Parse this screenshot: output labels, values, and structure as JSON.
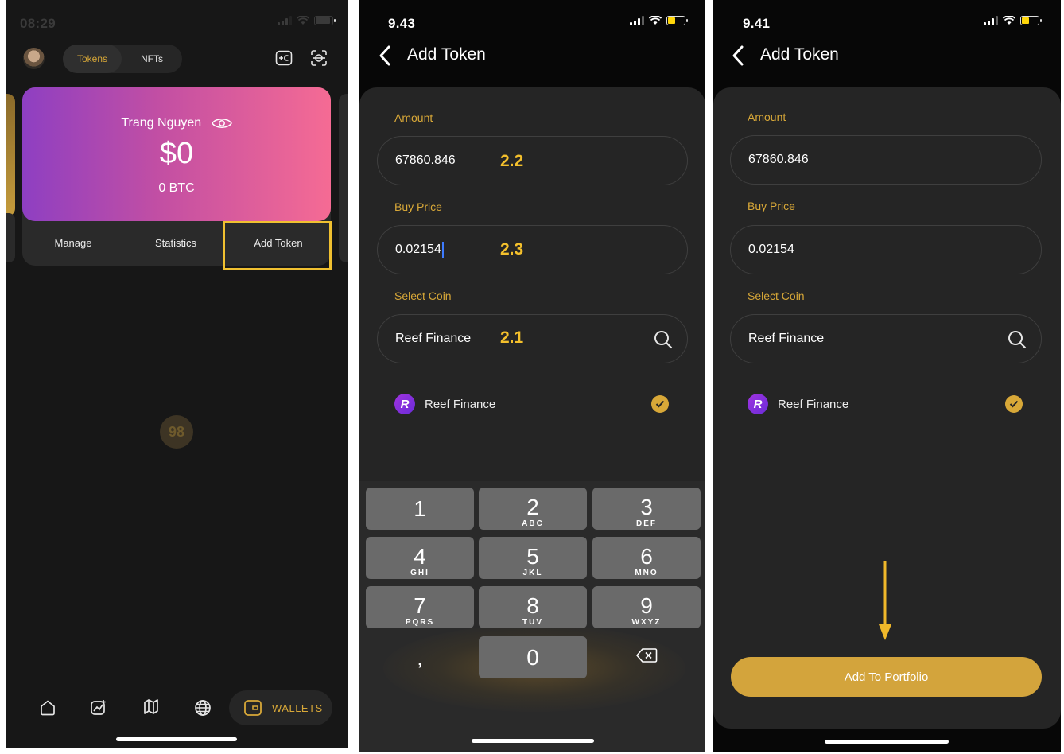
{
  "screen1": {
    "status_time": "08:29",
    "tabs": {
      "tokens": "Tokens",
      "nfts": "NFTs"
    },
    "wallet_card": {
      "name": "Trang Nguyen",
      "balance": "$0",
      "btc": "0 BTC"
    },
    "actions": {
      "manage": "Manage",
      "statistics": "Statistics",
      "add_token": "Add Token"
    },
    "center_logo": "98",
    "nav": {
      "wallets": "WALLETS"
    },
    "colors": {
      "accent": "#d8a838",
      "highlight": "#f0c030"
    }
  },
  "screen2": {
    "status_time": "9.43",
    "title": "Add Token",
    "amount_label": "Amount",
    "amount_value": "67860.846",
    "amount_annotation": "2.2",
    "buy_price_label": "Buy Price",
    "buy_price_value": "0.02154",
    "buy_price_annotation": "2.3",
    "select_coin_label": "Select Coin",
    "select_coin_value": "Reef Finance",
    "select_coin_annotation": "2.1",
    "coin_result": "Reef Finance",
    "keypad": [
      {
        "digit": "1",
        "letters": ""
      },
      {
        "digit": "2",
        "letters": "ABC"
      },
      {
        "digit": "3",
        "letters": "DEF"
      },
      {
        "digit": "4",
        "letters": "GHI"
      },
      {
        "digit": "5",
        "letters": "JKL"
      },
      {
        "digit": "6",
        "letters": "MNO"
      },
      {
        "digit": "7",
        "letters": "PQRS"
      },
      {
        "digit": "8",
        "letters": "TUV"
      },
      {
        "digit": "9",
        "letters": "WXYZ"
      },
      {
        "digit": ",",
        "letters": ""
      },
      {
        "digit": "0",
        "letters": ""
      }
    ]
  },
  "screen3": {
    "status_time": "9.41",
    "title": "Add Token",
    "amount_label": "Amount",
    "amount_value": "67860.846",
    "buy_price_label": "Buy Price",
    "buy_price_value": "0.02154",
    "select_coin_label": "Select Coin",
    "select_coin_value": "Reef Finance",
    "coin_result": "Reef Finance",
    "add_button": "Add To Portfolio"
  }
}
